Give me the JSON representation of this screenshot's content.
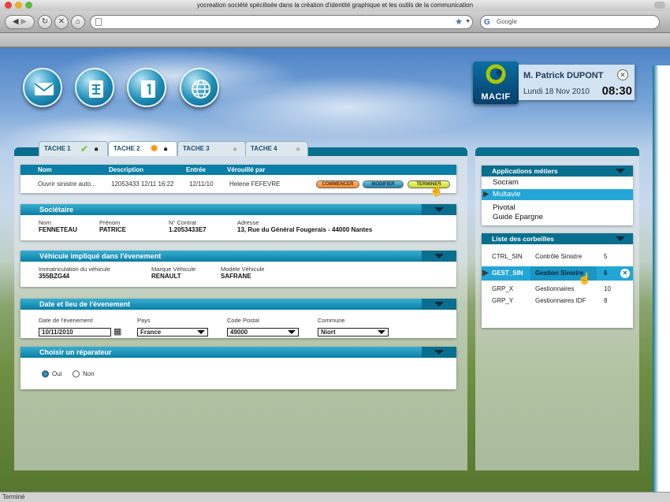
{
  "window": {
    "title": "yocreation société spécilisée dans la création d'identité graphique et les outils de la communication",
    "status": "Terminé"
  },
  "toolbar": {
    "search_placeholder": "Google",
    "url": ""
  },
  "header": {
    "logo_text": "MACIF",
    "user_name": "M. Patrick DUPONT",
    "date": "Lundi 18 Nov 2010",
    "time": "08:30"
  },
  "tabs": [
    {
      "label": "TACHE 1",
      "status": "done"
    },
    {
      "label": "TACHE 2",
      "status": "in-progress"
    },
    {
      "label": "TACHE 3",
      "status": "locked"
    },
    {
      "label": "TACHE 4",
      "status": "locked"
    }
  ],
  "task_table": {
    "headers": [
      "Nom",
      "Description",
      "Entrée",
      "Vérouillé par"
    ],
    "row": {
      "nom": "Ouvrir sinistre auto...",
      "description": "12053433 12/11 16:22",
      "entree": "12/11/10",
      "verrouille_par": "Helene FEFEVRE"
    },
    "buttons": {
      "commencer": "COMMENCER",
      "modifier": "MODIFIER",
      "terminer": "TERMINER"
    }
  },
  "societaire": {
    "title": "Sociétaire",
    "nom_label": "Nom",
    "nom": "FENNETEAU",
    "prenom_label": "Prénom",
    "prenom": "PATRICE",
    "contrat_label": "N° Contrat",
    "contrat": "1.2053433E7",
    "adresse_label": "Adresse",
    "adresse": "13, Rue du Général Fougerais - 44000 Nantes"
  },
  "vehicule": {
    "title": "Véhicule impliqué dans l'évenement",
    "immat_label": "Immatriculation du véhicule",
    "immat": "355BZG44",
    "marque_label": "Marque Véhicule",
    "marque": "RENAULT",
    "modele_label": "Modèle Véhicule",
    "modele": "SAFRANE"
  },
  "evenement": {
    "title": "Date et lieu de l'évenement",
    "date_label": "Date de l'évenement",
    "date": "10/11/2010",
    "pays_label": "Pays",
    "pays": "France",
    "cp_label": "Code Postal",
    "cp": "49000",
    "commune_label": "Commune",
    "commune": "Niort"
  },
  "reparateur": {
    "title": "Choisir un réparateur",
    "oui": "Oui",
    "non": "Non",
    "selected": "oui"
  },
  "applications": {
    "title": "Applications métiers",
    "items": [
      "Socram",
      "Multavie",
      "Pivotal",
      "Guide Epargne"
    ],
    "selected": 1
  },
  "corbeilles": {
    "title": "Liste des corbeilles",
    "rows": [
      {
        "code": "CTRL_SIN",
        "name": "Contrôle Sinistre",
        "count": "5"
      },
      {
        "code": "GEST_SIN",
        "name": "Gestion Sinistre",
        "count": "6"
      },
      {
        "code": "GRP_X",
        "name": "Gestionnaires",
        "count": "10"
      },
      {
        "code": "GRP_Y",
        "name": "Gestionnaires IDF",
        "count": "8"
      }
    ],
    "selected": 1
  },
  "colors": {
    "accent": "#0a7ea5",
    "accent_dark": "#0a6f8e",
    "selection": "#23a6d5"
  }
}
